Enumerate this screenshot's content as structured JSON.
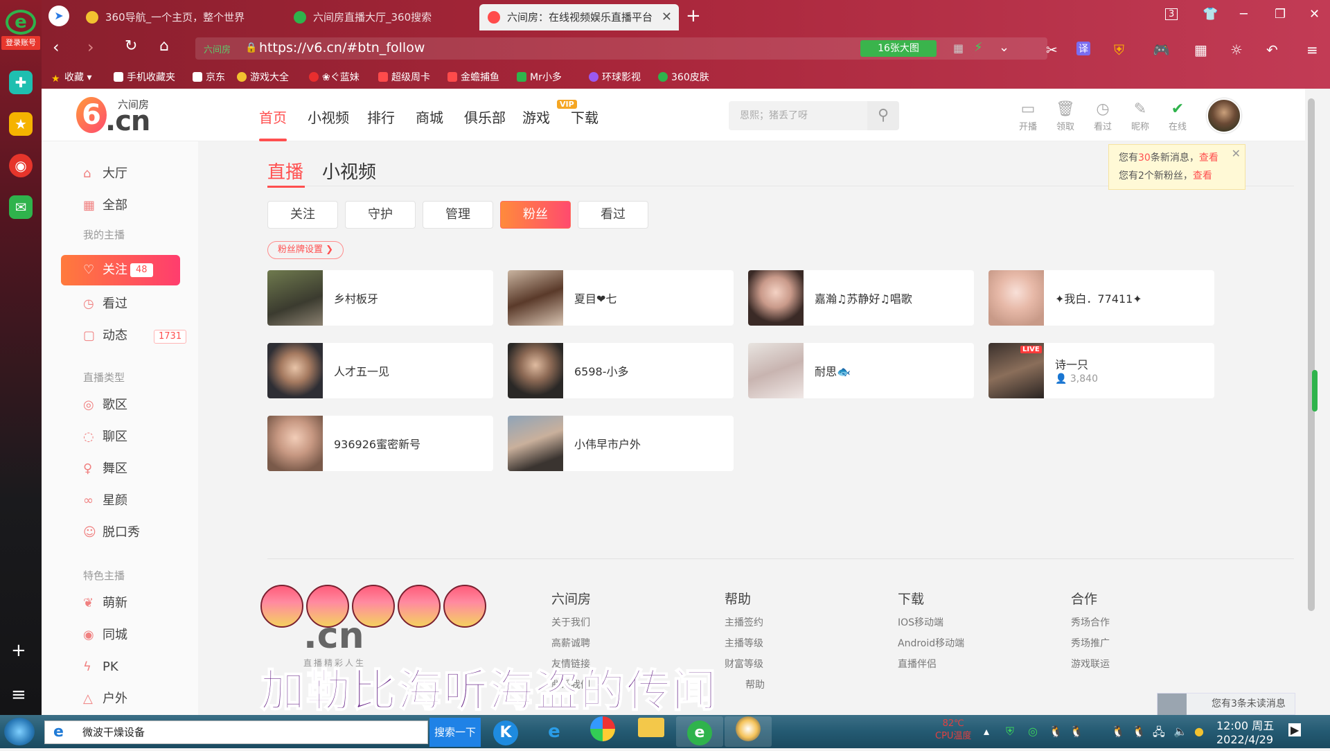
{
  "rail": {
    "logo": "e",
    "login": "登录账号",
    "icons": [
      "plus-icon",
      "star-icon",
      "weibo-icon",
      "mail-icon"
    ],
    "bottom": [
      "+",
      "≡"
    ]
  },
  "tabs": [
    {
      "label": "360导航_一个主页，整个世界",
      "color": "#f2c230"
    },
    {
      "label": "六间房直播大厅_360搜索",
      "color": "#2fb34c"
    },
    {
      "label": "六间房：在线视频娱乐直播平台",
      "color": "#ff4b4b",
      "active": true
    }
  ],
  "window": {
    "tab_count": "3"
  },
  "address": {
    "site_label": "六间房",
    "url": "https://v6.cn/#btn_follow",
    "pill": "16张大图"
  },
  "bookmarks": [
    "收藏",
    "手机收藏夹",
    "京东",
    "游戏大全",
    "❀ぐ蓝妹",
    "超级周卡",
    "金蟾捕鱼",
    "Mr小多",
    "环球影视",
    "360皮肤"
  ],
  "header": {
    "brand_zh": "六间房",
    "brand_cn": ".cn",
    "nav": [
      "首页",
      "小视频",
      "排行",
      "商城",
      "俱乐部",
      "游戏",
      "下载"
    ],
    "vip": "VIP",
    "search_placeholder": "恩熙；猪丢了呀",
    "quick": [
      "开播",
      "领取",
      "看过",
      "昵称",
      "在线"
    ]
  },
  "sidebar": {
    "items": [
      "大厅",
      "全部"
    ],
    "group1": "我的主播",
    "follow": {
      "label": "关注",
      "count": "48"
    },
    "watched": "看过",
    "feed": {
      "label": "动态",
      "count": "1731"
    },
    "group2": "直播类型",
    "types": [
      "歌区",
      "聊区",
      "舞区",
      "星颜",
      "脱口秀"
    ],
    "group3": "特色主播",
    "special": [
      "萌新",
      "同城",
      "PK",
      "户外"
    ]
  },
  "content": {
    "tabs": [
      "直播",
      "小视频"
    ],
    "filters": [
      "关注",
      "守护",
      "管理",
      "粉丝",
      "看过"
    ],
    "badge_setting": "粉丝牌设置 ❯",
    "cards": [
      {
        "name": "乡村板牙"
      },
      {
        "name": "夏目❤七"
      },
      {
        "name": "嘉瀚♫苏静好♫唱歌"
      },
      {
        "name": "✦我白．77411✦"
      },
      {
        "name": "人才五一见"
      },
      {
        "name": "6598-小多"
      },
      {
        "name": "耐思🐟"
      },
      {
        "name": "诗一只",
        "live": "LIVE",
        "viewers": "3,840"
      },
      {
        "name": "936926蜜密新号"
      },
      {
        "name": "小伟早市户外"
      }
    ]
  },
  "notice": {
    "line1_pre": "您有",
    "line1_num": "30",
    "line1_post": "条新消息，",
    "line1_link": "查看",
    "line2_pre": "您有2个新粉丝，",
    "line2_link": "查看"
  },
  "footer": {
    "cols": [
      {
        "title": "六间房",
        "links": [
          "关于我们",
          "高薪诚聘",
          "友情链接",
          "联系我们"
        ]
      },
      {
        "title": "帮助",
        "links": [
          "主播签约",
          "主播等级",
          "财富等级",
          "帮助"
        ]
      },
      {
        "title": "下载",
        "links": [
          "IOS移动端",
          "Android移动端",
          "直播伴侣"
        ]
      },
      {
        "title": "合作",
        "links": [
          "秀场合作",
          "秀场推广",
          "游戏联运"
        ]
      }
    ],
    "logo": ".cn",
    "logo_sub": "直播精彩人生"
  },
  "overlay_subtitle": "加勒比海听海盗的传闻",
  "unread": "您有3条未读消息",
  "taskbar": {
    "input": "微波干燥设备",
    "search": "搜索一下",
    "cpu_temp": "82℃",
    "cpu_label": "CPU温度",
    "time": "12:00 周五",
    "date": "2022/4/29"
  }
}
